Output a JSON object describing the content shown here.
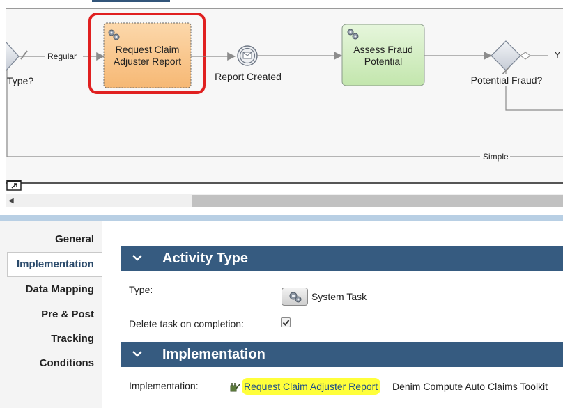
{
  "diagram": {
    "nodes": {
      "request_claim": "Request Claim\nAdjuster Report",
      "request_claim_l1": "Request Claim",
      "request_claim_l2": "Adjuster Report",
      "report_created": "Report Created",
      "assess_fraud_l1": "Assess Fraud",
      "assess_fraud_l2": "Potential",
      "potential_fraud": "Potential Fraud?",
      "type_gateway": "Type?"
    },
    "flows": {
      "regular": "Regular",
      "simple": "Simple",
      "yes_partial": "Y"
    },
    "colors": {
      "highlight_box": "#e02020",
      "selected_task": "#f9c486",
      "fraud_task": "#d3efc4"
    }
  },
  "nav": {
    "items": [
      "General",
      "Implementation",
      "Data Mapping",
      "Pre & Post",
      "Tracking",
      "Conditions"
    ],
    "active_index": 1
  },
  "activity_type": {
    "title": "Activity Type",
    "type_label": "Type:",
    "type_value": "System Task",
    "delete_label": "Delete task on completion:",
    "delete_checked": true
  },
  "implementation": {
    "title": "Implementation",
    "label": "Implementation:",
    "link_text": "Request Claim Adjuster Report",
    "description": "Denim Compute Auto Claims Toolkit"
  },
  "icons": {
    "gears": "gears-icon",
    "expand": "expand-icon",
    "scroll_left": "scroll-left-icon",
    "collapse": "chevron-down-icon",
    "service": "service-plug-icon",
    "check": "check-icon"
  }
}
